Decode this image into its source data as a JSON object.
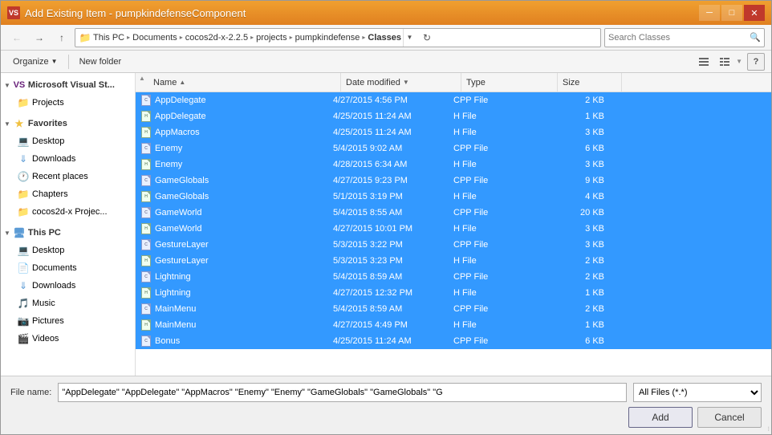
{
  "window": {
    "title": "Add Existing Item - pumpkindefenseComponent",
    "min_btn": "─",
    "max_btn": "□",
    "close_btn": "✕",
    "vs_icon": "VS"
  },
  "toolbar": {
    "back_title": "Back",
    "forward_title": "Forward",
    "up_title": "Up",
    "address": {
      "parts": [
        "This PC",
        "Documents",
        "cocos2d-x-2.2.5",
        "projects",
        "pumpkindefense",
        "Classes"
      ]
    },
    "refresh_title": "Refresh",
    "search_placeholder": "Search Classes",
    "dropdown_title": "Dropdown"
  },
  "toolbar2": {
    "organize_label": "Organize",
    "new_folder_label": "New folder",
    "view_list_title": "View as list",
    "view_details_title": "View details",
    "help_label": "?"
  },
  "left_panel": {
    "sections": [
      {
        "id": "visual-studio",
        "label": "Microsoft Visual St...",
        "type": "vs",
        "indent": 0,
        "children": [
          {
            "id": "projects",
            "label": "Projects",
            "type": "folder",
            "indent": 1
          }
        ]
      },
      {
        "id": "favorites",
        "label": "Favorites",
        "type": "star",
        "indent": 0,
        "children": [
          {
            "id": "desktop-fav",
            "label": "Desktop",
            "type": "desktop",
            "indent": 1
          },
          {
            "id": "downloads-fav",
            "label": "Downloads",
            "type": "downloads",
            "indent": 1
          },
          {
            "id": "recent-places",
            "label": "Recent places",
            "type": "recent",
            "indent": 1
          },
          {
            "id": "chapters",
            "label": "Chapters",
            "type": "folder",
            "indent": 1
          },
          {
            "id": "cocos2d",
            "label": "cocos2d-x Projec...",
            "type": "folder",
            "indent": 1
          }
        ]
      },
      {
        "id": "this-pc",
        "label": "This PC",
        "type": "pc",
        "indent": 0,
        "children": [
          {
            "id": "desktop-pc",
            "label": "Desktop",
            "type": "desktop",
            "indent": 1
          },
          {
            "id": "documents-pc",
            "label": "Documents",
            "type": "documents",
            "indent": 1
          },
          {
            "id": "downloads-pc",
            "label": "Downloads",
            "type": "downloads",
            "indent": 1
          },
          {
            "id": "music-pc",
            "label": "Music",
            "type": "folder",
            "indent": 1
          },
          {
            "id": "pictures-pc",
            "label": "Pictures",
            "type": "folder",
            "indent": 1
          },
          {
            "id": "videos-pc",
            "label": "Videos",
            "type": "folder",
            "indent": 1
          }
        ]
      }
    ]
  },
  "file_list": {
    "columns": [
      {
        "id": "name",
        "label": "Name",
        "sort": "asc"
      },
      {
        "id": "date",
        "label": "Date modified"
      },
      {
        "id": "type",
        "label": "Type"
      },
      {
        "id": "size",
        "label": "Size"
      }
    ],
    "files": [
      {
        "name": "AppDelegate",
        "date": "4/27/2015 4:56 PM",
        "type": "CPP File",
        "size": "2 KB",
        "file_type": "cpp"
      },
      {
        "name": "AppDelegate",
        "date": "4/25/2015 11:24 AM",
        "type": "H File",
        "size": "1 KB",
        "file_type": "h"
      },
      {
        "name": "AppMacros",
        "date": "4/25/2015 11:24 AM",
        "type": "H File",
        "size": "3 KB",
        "file_type": "h"
      },
      {
        "name": "Enemy",
        "date": "5/4/2015 9:02 AM",
        "type": "CPP File",
        "size": "6 KB",
        "file_type": "cpp"
      },
      {
        "name": "Enemy",
        "date": "4/28/2015 6:34 AM",
        "type": "H File",
        "size": "3 KB",
        "file_type": "h"
      },
      {
        "name": "GameGlobals",
        "date": "4/27/2015 9:23 PM",
        "type": "CPP File",
        "size": "9 KB",
        "file_type": "cpp"
      },
      {
        "name": "GameGlobals",
        "date": "5/1/2015 3:19 PM",
        "type": "H File",
        "size": "4 KB",
        "file_type": "h"
      },
      {
        "name": "GameWorld",
        "date": "5/4/2015 8:55 AM",
        "type": "CPP File",
        "size": "20 KB",
        "file_type": "cpp"
      },
      {
        "name": "GameWorld",
        "date": "4/27/2015 10:01 PM",
        "type": "H File",
        "size": "3 KB",
        "file_type": "h"
      },
      {
        "name": "GestureLayer",
        "date": "5/3/2015 3:22 PM",
        "type": "CPP File",
        "size": "3 KB",
        "file_type": "cpp"
      },
      {
        "name": "GestureLayer",
        "date": "5/3/2015 3:23 PM",
        "type": "H File",
        "size": "2 KB",
        "file_type": "h"
      },
      {
        "name": "Lightning",
        "date": "5/4/2015 8:59 AM",
        "type": "CPP File",
        "size": "2 KB",
        "file_type": "cpp"
      },
      {
        "name": "Lightning",
        "date": "4/27/2015 12:32 PM",
        "type": "H File",
        "size": "1 KB",
        "file_type": "h"
      },
      {
        "name": "MainMenu",
        "date": "5/4/2015 8:59 AM",
        "type": "CPP File",
        "size": "2 KB",
        "file_type": "cpp"
      },
      {
        "name": "MainMenu",
        "date": "4/27/2015 4:49 PM",
        "type": "H File",
        "size": "1 KB",
        "file_type": "h"
      },
      {
        "name": "Bonus",
        "date": "4/25/2015 11:24 AM",
        "type": "CPP File",
        "size": "6 KB",
        "file_type": "cpp"
      }
    ]
  },
  "bottom": {
    "filename_label": "File name:",
    "filename_value": "\"AppDelegate\" \"AppDelegate\" \"AppMacros\" \"Enemy\" \"Enemy\" \"GameGlobals\" \"GameGlobals\" \"G",
    "filetype_value": "All Files (*.*)",
    "add_label": "Add",
    "cancel_label": "Cancel"
  }
}
